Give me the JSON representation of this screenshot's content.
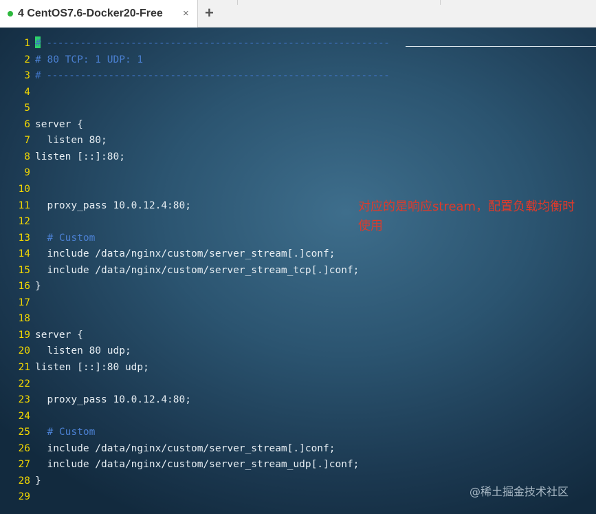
{
  "tab": {
    "title": "4 CentOS7.6-Docker20-Free",
    "close_label": "×",
    "new_tab_label": "+"
  },
  "editor": {
    "lines": [
      {
        "num": "1",
        "text": "# -------------------------------------------------------------",
        "kind": "comment-dashed"
      },
      {
        "num": "2",
        "text": "# 80 TCP: 1 UDP: 1",
        "kind": "comment"
      },
      {
        "num": "3",
        "text": "# -------------------------------------------------------------",
        "kind": "comment-dashed"
      },
      {
        "num": "4",
        "text": "",
        "kind": "code"
      },
      {
        "num": "5",
        "text": "",
        "kind": "code"
      },
      {
        "num": "6",
        "text": "server {",
        "kind": "code"
      },
      {
        "num": "7",
        "text": "  listen 80;",
        "kind": "code"
      },
      {
        "num": "8",
        "text": "listen [::]:80;",
        "kind": "code"
      },
      {
        "num": "9",
        "text": "",
        "kind": "code"
      },
      {
        "num": "10",
        "text": "",
        "kind": "code"
      },
      {
        "num": "11",
        "text": "  proxy_pass 10.0.12.4:80;",
        "kind": "code"
      },
      {
        "num": "12",
        "text": "",
        "kind": "code"
      },
      {
        "num": "13",
        "text": "  # Custom",
        "kind": "comment"
      },
      {
        "num": "14",
        "text": "  include /data/nginx/custom/server_stream[.]conf;",
        "kind": "code"
      },
      {
        "num": "15",
        "text": "  include /data/nginx/custom/server_stream_tcp[.]conf;",
        "kind": "code"
      },
      {
        "num": "16",
        "text": "}",
        "kind": "code"
      },
      {
        "num": "17",
        "text": "",
        "kind": "code"
      },
      {
        "num": "18",
        "text": "",
        "kind": "code"
      },
      {
        "num": "19",
        "text": "server {",
        "kind": "code"
      },
      {
        "num": "20",
        "text": "  listen 80 udp;",
        "kind": "code"
      },
      {
        "num": "21",
        "text": "listen [::]:80 udp;",
        "kind": "code"
      },
      {
        "num": "22",
        "text": "",
        "kind": "code"
      },
      {
        "num": "23",
        "text": "  proxy_pass 10.0.12.4:80;",
        "kind": "code"
      },
      {
        "num": "24",
        "text": "",
        "kind": "code"
      },
      {
        "num": "25",
        "text": "  # Custom",
        "kind": "comment"
      },
      {
        "num": "26",
        "text": "  include /data/nginx/custom/server_stream[.]conf;",
        "kind": "code"
      },
      {
        "num": "27",
        "text": "  include /data/nginx/custom/server_stream_udp[.]conf;",
        "kind": "code"
      },
      {
        "num": "28",
        "text": "}",
        "kind": "code"
      },
      {
        "num": "29",
        "text": "",
        "kind": "code"
      }
    ]
  },
  "annotation": "对应的是响应stream，配置负载均衡时使用",
  "watermark": "@稀土掘金技术社区",
  "colors": {
    "line_number": "#f2d700",
    "comment": "#4a7fd0",
    "annotation": "#e03a2a",
    "cursor": "#2dd36a",
    "status_dot": "#2db83d"
  }
}
